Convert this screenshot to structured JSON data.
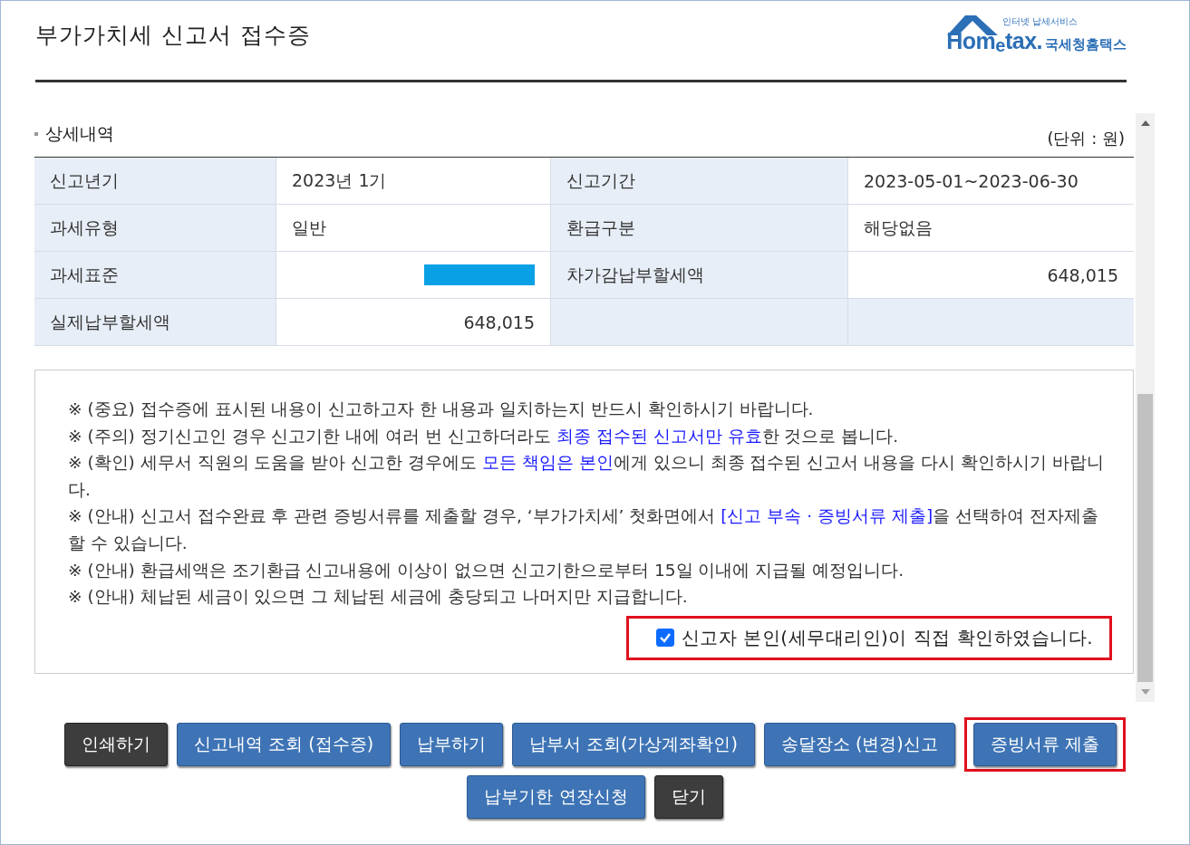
{
  "header": {
    "title": "부가가치세 신고서 접수증",
    "logo": {
      "tagline": "인터넷 납세서비스",
      "wordmark": "Hom$_{e}$tax.",
      "name": "국세청홈택스"
    }
  },
  "section": {
    "title": "상세내역",
    "unit": "(단위 : 원)"
  },
  "table": {
    "rows": [
      [
        {
          "kind": "label",
          "text": "신고년기"
        },
        {
          "kind": "text",
          "text": "2023년 1기"
        },
        {
          "kind": "label",
          "text": "신고기간"
        },
        {
          "kind": "text",
          "text": "2023-05-01~2023-06-30"
        }
      ],
      [
        {
          "kind": "label",
          "text": "과세유형"
        },
        {
          "kind": "text",
          "text": "일반"
        },
        {
          "kind": "label",
          "text": "환급구분"
        },
        {
          "kind": "text",
          "text": "해당없음"
        }
      ],
      [
        {
          "kind": "label",
          "text": "과세표준"
        },
        {
          "kind": "redacted"
        },
        {
          "kind": "label",
          "text": "차가감납부할세액"
        },
        {
          "kind": "number",
          "text": "648,015"
        }
      ],
      [
        {
          "kind": "label",
          "text": "실제납부할세액"
        },
        {
          "kind": "number",
          "text": "648,015"
        },
        {
          "kind": "blank"
        },
        {
          "kind": "blank"
        }
      ]
    ]
  },
  "notices": [
    "※ (중요) 접수증에 표시된 내용이 신고하고자 한 내용과 일치하는지 반드시 확인하시기 바랍니다.",
    "※ (주의) 정기신고인 경우 신고기한 내에 여러 번 신고하더라도 **최종 접수된 신고서만 유효**한 것으로 봅니다.",
    "※ (확인) 세무서 직원의 도움을 받아 신고한 경우에도 **모든 책임은 본인**에게 있으니 최종 접수된 신고서 내용을 다시 확인하시기 바랍니다.",
    "※ (안내) 신고서 접수완료 후 관련 증빙서류를 제출할 경우, ‘부가가치세’ 첫화면에서 **[신고 부속 · 증빙서류 제출]**을 선택하여 전자제출할 수 있습니다.",
    "※ (안내) 환급세액은 조기환급 신고내용에 이상이 없으면 신고기한으로부터 15일 이내에 지급될 예정입니다.",
    "※ (안내) 체납된 세금이 있으면 그 체납된 세금에 충당되고 나머지만 지급합니다."
  ],
  "confirmation": {
    "text": "신고자 본인(세무대리인)이 직접 확인하였습니다.",
    "checked": true,
    "highlighted": true
  },
  "button_rows": [
    [
      {
        "label": "인쇄하기",
        "kind": "dark",
        "highlighted": false
      },
      {
        "label": "신고내역 조회 (접수증)",
        "kind": "blue",
        "highlighted": false
      },
      {
        "label": "납부하기",
        "kind": "blue",
        "highlighted": false
      },
      {
        "label": "납부서 조회(가상계좌확인)",
        "kind": "blue",
        "highlighted": false
      },
      {
        "label": "송달장소 (변경)신고",
        "kind": "blue",
        "highlighted": false
      },
      {
        "label": "증빙서류 제출",
        "kind": "blue",
        "highlighted": true
      }
    ],
    [
      {
        "label": "납부기한 연장신청",
        "kind": "blue",
        "highlighted": false
      },
      {
        "label": "닫기",
        "kind": "dark",
        "highlighted": false
      }
    ]
  ]
}
